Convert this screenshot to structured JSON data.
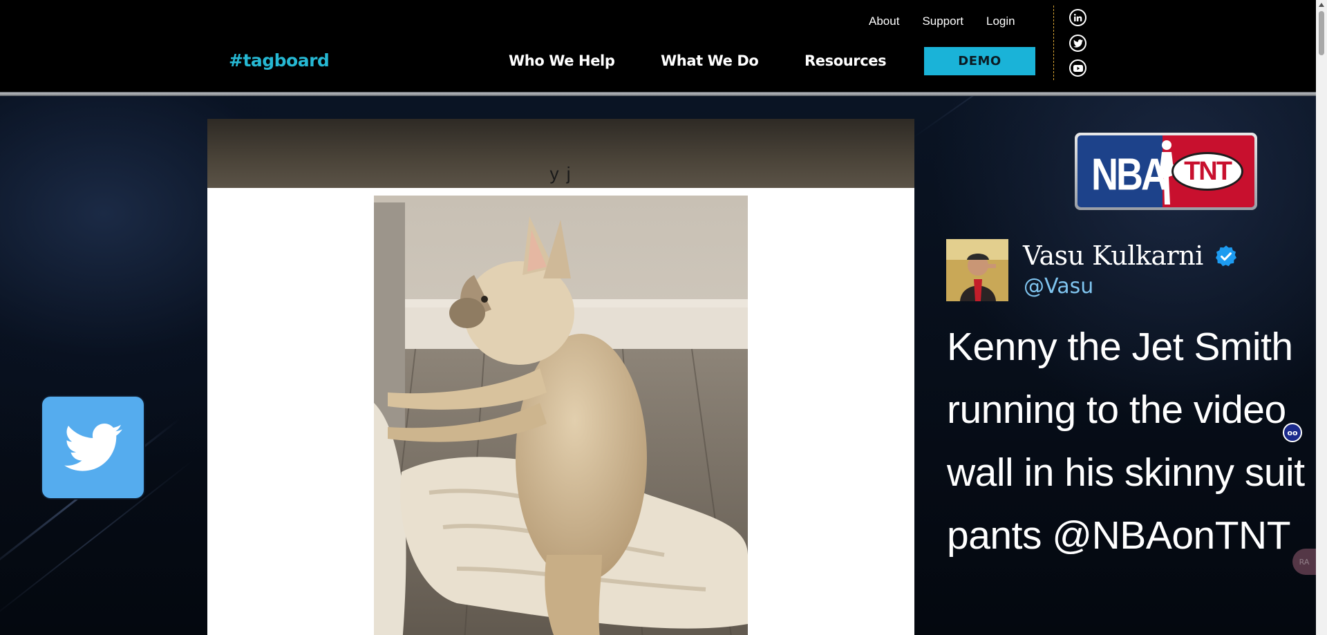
{
  "header": {
    "logo": "#tagboard",
    "util_nav": [
      "About",
      "Support",
      "Login"
    ],
    "main_nav": {
      "who": "Who We Help",
      "what": "What We Do",
      "resources": "Resources"
    },
    "demo_label": "DEMO",
    "social": [
      "linkedin-icon",
      "twitter-icon",
      "youtube-icon"
    ]
  },
  "hero": {
    "media": {
      "caption_fragment": "y j"
    },
    "nba_logo": {
      "left": "NBA",
      "right": "TNT"
    },
    "tweet": {
      "name": "Vasu Kulkarni",
      "handle": "@Vasu",
      "verified": true,
      "text": "Kenny the Jet Smith running to the video wall in his skinny suit pants @NBAonTNT"
    },
    "overlay": {
      "accessibility_label": "oo",
      "side_pill_label": "RA"
    }
  },
  "colors": {
    "brand_cyan": "#26b8d3",
    "demo_button": "#1ab3d8",
    "twitter_blue": "#55acee",
    "divider": "#d8a533",
    "handle_blue": "#7fc4ef"
  }
}
